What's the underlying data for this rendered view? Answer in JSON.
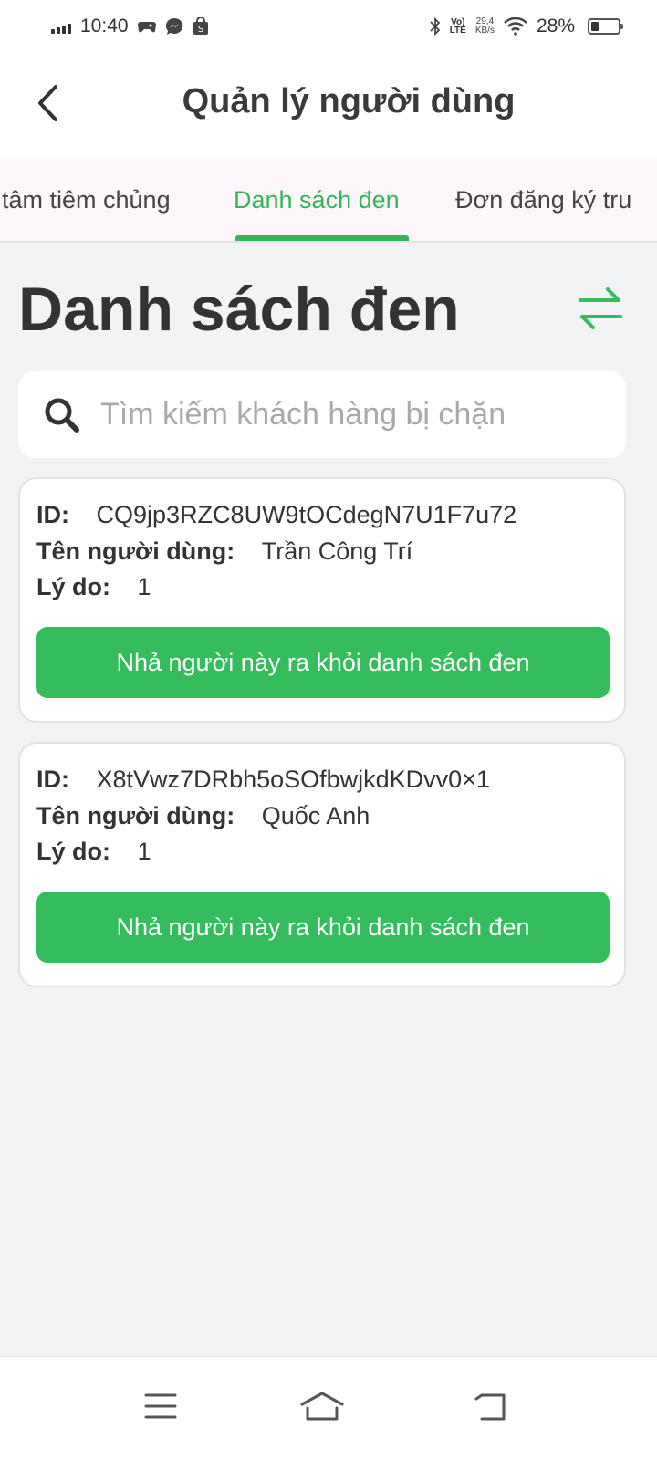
{
  "status_bar": {
    "time": "10:40",
    "network_speed_value": "29,4",
    "network_speed_unit": "KB/s",
    "volte_top": "Vo)",
    "volte_bottom": "LTE",
    "battery_percent": "28%",
    "battery_level": 0.28,
    "icons": [
      "signal-icon",
      "game-icon",
      "messenger-icon",
      "shop-icon",
      "bluetooth-icon",
      "volte-icon",
      "wifi-icon",
      "battery-icon"
    ]
  },
  "app_bar": {
    "title": "Quản lý người dùng",
    "back_icon": "chevron-left-icon"
  },
  "tabs": [
    {
      "label": "tâm tiêm chủng",
      "active": false
    },
    {
      "label": "Danh sách đen",
      "active": true
    },
    {
      "label": "Đơn đăng ký tru",
      "active": false
    }
  ],
  "page": {
    "title": "Danh sách đen",
    "swap_icon": "swap-arrows-icon"
  },
  "search": {
    "placeholder": "Tìm kiếm khách hàng bị chặn",
    "value": ""
  },
  "labels": {
    "id": "ID:",
    "user_name": "Tên người dùng:",
    "reason": "Lý do:"
  },
  "users": [
    {
      "id": "CQ9jp3RZC8UW9tOCdegN7U1F7u72",
      "name": "Trần Công Trí",
      "reason": "1",
      "button_label": "Nhả người này ra khỏi danh sách đen"
    },
    {
      "id": "X8tVwz7DRbh5oSOfbwjkdKDvv0×1",
      "name": "Quốc Anh",
      "reason": "1",
      "button_label": "Nhả người này ra khỏi danh sách đen"
    }
  ],
  "colors": {
    "accent": "#35bd5d",
    "background": "#f2f3f5",
    "tab_background": "#fdf7fb"
  },
  "nav_bar": {
    "icons": [
      "menu-icon",
      "home-icon",
      "back-icon"
    ]
  }
}
